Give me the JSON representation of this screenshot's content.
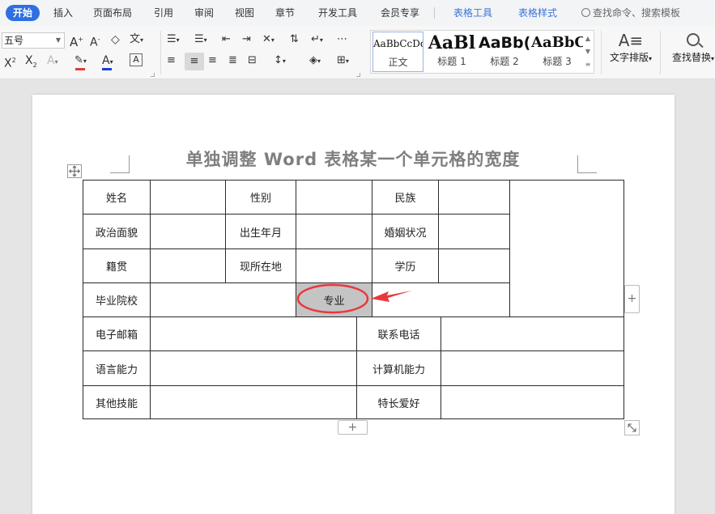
{
  "menu": {
    "items": [
      "开始",
      "插入",
      "页面布局",
      "引用",
      "审阅",
      "视图",
      "章节",
      "开发工具",
      "会员专享",
      "表格工具",
      "表格样式"
    ],
    "search_placeholder": "查找命令、搜索模板",
    "active_tab": "开始",
    "accent_color": "#2f6fe0"
  },
  "ribbon": {
    "font_size_value": "五号",
    "styles": [
      {
        "preview": "AaBbCcDd",
        "name": "正文"
      },
      {
        "preview": "AaBl",
        "name": "标题 1"
      },
      {
        "preview": "AaBb(",
        "name": "标题 2"
      },
      {
        "preview": "AaBbC",
        "name": "标题 3"
      }
    ],
    "text_layout_label": "文字排版",
    "find_replace_label": "查找替换",
    "icons": [
      "grow-font-icon",
      "shrink-font-icon",
      "clear-format-icon",
      "phonetic-icon",
      "bullets-icon",
      "numbering-icon",
      "decrease-indent-icon",
      "increase-indent-icon",
      "chinese-layout-icon",
      "sort-icon",
      "show-marks-icon",
      "superscript-icon",
      "subscript-icon",
      "text-effect-icon",
      "highlight-icon",
      "font-color-icon",
      "char-border-icon",
      "align-left-icon",
      "align-center-icon",
      "align-right-icon",
      "justify-icon",
      "distribute-icon",
      "line-spacing-icon",
      "shading-icon",
      "borders-icon",
      "text-layout-icon",
      "find-replace-icon"
    ],
    "highlight_color": "#e23b3b",
    "font_color": "#1f3cd6"
  },
  "document": {
    "title": "单独调整 Word 表格某一个单元格的宽度",
    "table": {
      "row1": [
        "姓名",
        "",
        "性别",
        "",
        "民族",
        ""
      ],
      "row2": [
        "政治面貌",
        "",
        "出生年月",
        "",
        "婚姻状况",
        ""
      ],
      "row3": [
        "籍贯",
        "",
        "现所在地",
        "",
        "学历",
        ""
      ],
      "row4": [
        "毕业院校",
        "",
        "专业",
        ""
      ],
      "row5": [
        "电子邮箱",
        "",
        "联系电话",
        ""
      ],
      "row6": [
        "语言能力",
        "",
        "计算机能力",
        ""
      ],
      "row7": [
        "其他技能",
        "",
        "特长爱好",
        ""
      ]
    },
    "selected_cell": "专业",
    "add_column_label": "+",
    "add_row_label": "+"
  },
  "annotation": {
    "color": "#e8383d",
    "target": "专业"
  }
}
